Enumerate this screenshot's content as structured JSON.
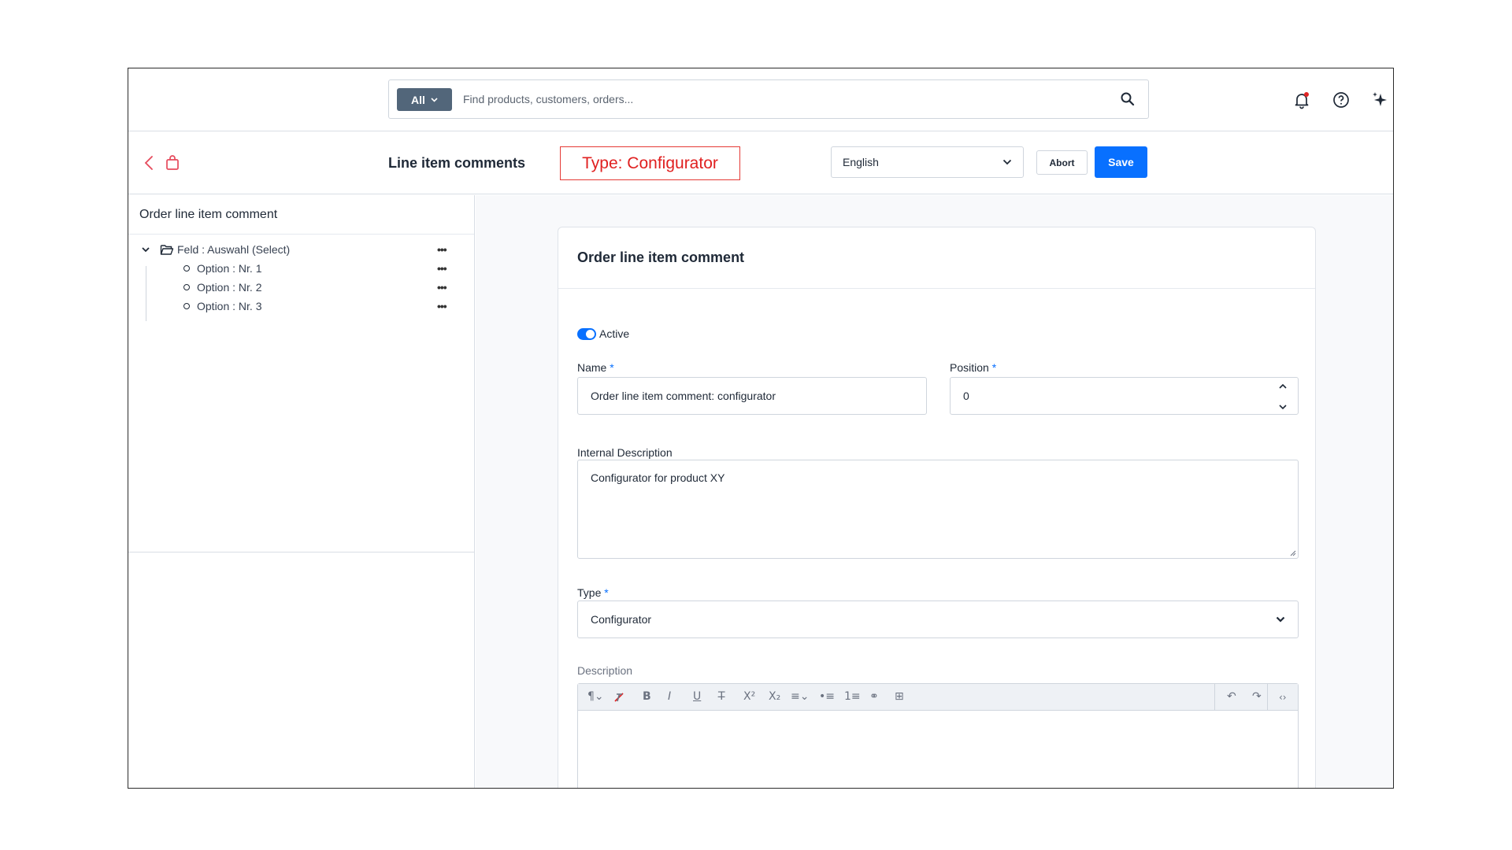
{
  "search": {
    "scope_label": "All",
    "placeholder": "Find products, customers, orders..."
  },
  "header": {
    "title": "Line item comments",
    "annotation": "Type: Configurator",
    "language": "English",
    "abort_label": "Abort",
    "save_label": "Save"
  },
  "tree": {
    "title": "Order line item comment",
    "root": "Feld : Auswahl (Select)",
    "options": [
      "Option : Nr. 1",
      "Option : Nr. 2",
      "Option : Nr. 3"
    ],
    "menu_glyph": "•••"
  },
  "form": {
    "card_title": "Order line item comment",
    "active_label": "Active",
    "active": true,
    "name_label": "Name",
    "name_value": "Order line item comment: configurator",
    "position_label": "Position",
    "position_value": "0",
    "required_mark": "*",
    "internal_description_label": "Internal Description",
    "internal_description_value": "Configurator for product XY",
    "type_label": "Type",
    "type_value": "Configurator",
    "description_label": "Description"
  },
  "colors": {
    "accent": "#0870ff",
    "annotation": "#e53935",
    "search_scope_bg": "#52667a"
  }
}
